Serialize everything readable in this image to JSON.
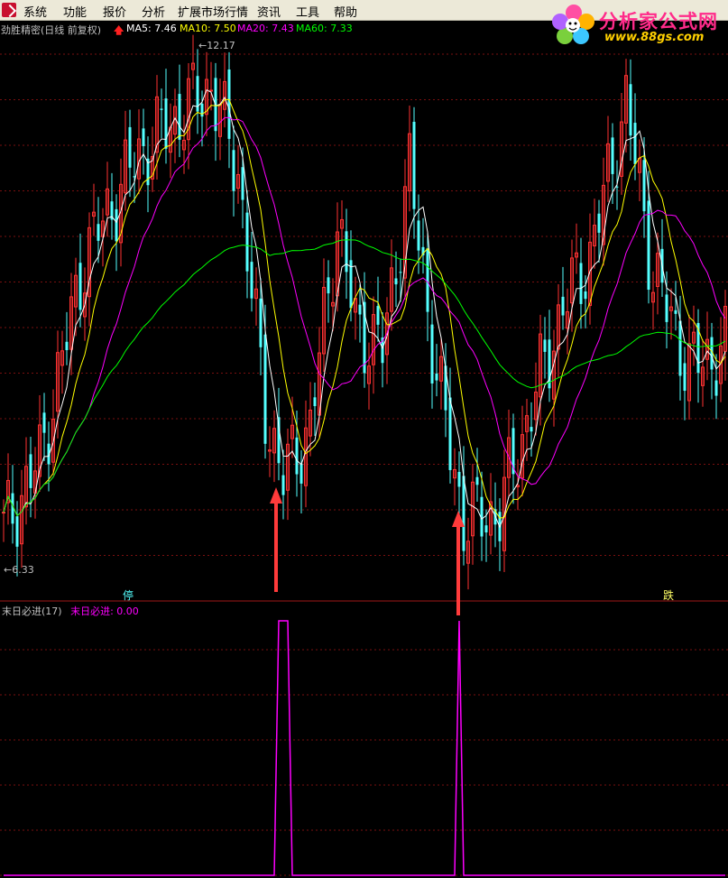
{
  "menu": {
    "items": [
      "系统",
      "功能",
      "报价",
      "分析",
      "扩展市场行情",
      "资讯",
      "工具",
      "帮助"
    ]
  },
  "logo": {
    "title": "分析家公式网",
    "url": "www.88gs.com",
    "icon": "flower-logo-icon"
  },
  "main_chart": {
    "title": "劲胜精密(日线 前复权)",
    "ma_indicators": [
      {
        "label": "MA5: 7.46",
        "color": "#ffffff"
      },
      {
        "label": "MA10: 7.50",
        "color": "#ffff00"
      },
      {
        "label": "MA20: 7.43",
        "color": "#ff00ff"
      },
      {
        "label": "MA60: 7.33",
        "color": "#00ff00"
      }
    ],
    "high_label": "12.17",
    "low_label": "6.33",
    "markers": {
      "left": "停",
      "right": "跌"
    },
    "colors": {
      "up": "#ff3232",
      "down": "#54ffff",
      "grid": "#7a1010"
    }
  },
  "indicator_panel": {
    "title": "末日必进(17)",
    "value_label": "末日必进: 0.00",
    "color": "#ff00ff"
  },
  "chart_data": {
    "type": "line",
    "series": [
      {
        "name": "末日必进",
        "values": [
          0,
          0,
          0,
          0,
          0,
          0,
          0,
          0,
          0,
          0,
          0,
          0,
          0,
          0,
          0,
          0,
          0,
          0,
          0,
          0,
          0,
          0,
          0,
          0,
          0,
          0,
          0,
          0,
          0,
          0,
          0,
          0,
          0,
          0,
          0,
          0,
          0,
          0,
          0,
          0,
          0,
          0,
          0,
          0,
          0,
          0,
          0,
          0,
          0,
          0,
          0,
          0,
          0,
          0,
          0,
          0,
          0,
          0,
          0,
          0,
          0,
          1,
          1,
          1,
          0,
          0,
          0,
          0,
          0,
          0,
          0,
          0,
          0,
          0,
          0,
          0,
          0,
          0,
          0,
          0,
          0,
          0,
          0,
          0,
          0,
          0,
          0,
          0,
          0,
          0,
          0,
          0,
          0,
          0,
          0,
          0,
          0,
          0,
          0,
          0,
          0,
          1,
          0,
          0,
          0,
          0,
          0,
          0,
          0,
          0,
          0,
          0,
          0,
          0,
          0,
          0,
          0,
          0,
          0,
          0,
          0,
          0,
          0,
          0,
          0,
          0,
          0,
          0,
          0,
          0,
          0,
          0,
          0,
          0,
          0,
          0,
          0,
          0,
          0,
          0,
          0,
          0,
          0,
          0,
          0,
          0,
          0,
          0,
          0,
          0,
          0,
          0,
          0,
          0,
          0,
          0,
          0,
          0,
          0,
          0,
          0
        ]
      }
    ]
  }
}
